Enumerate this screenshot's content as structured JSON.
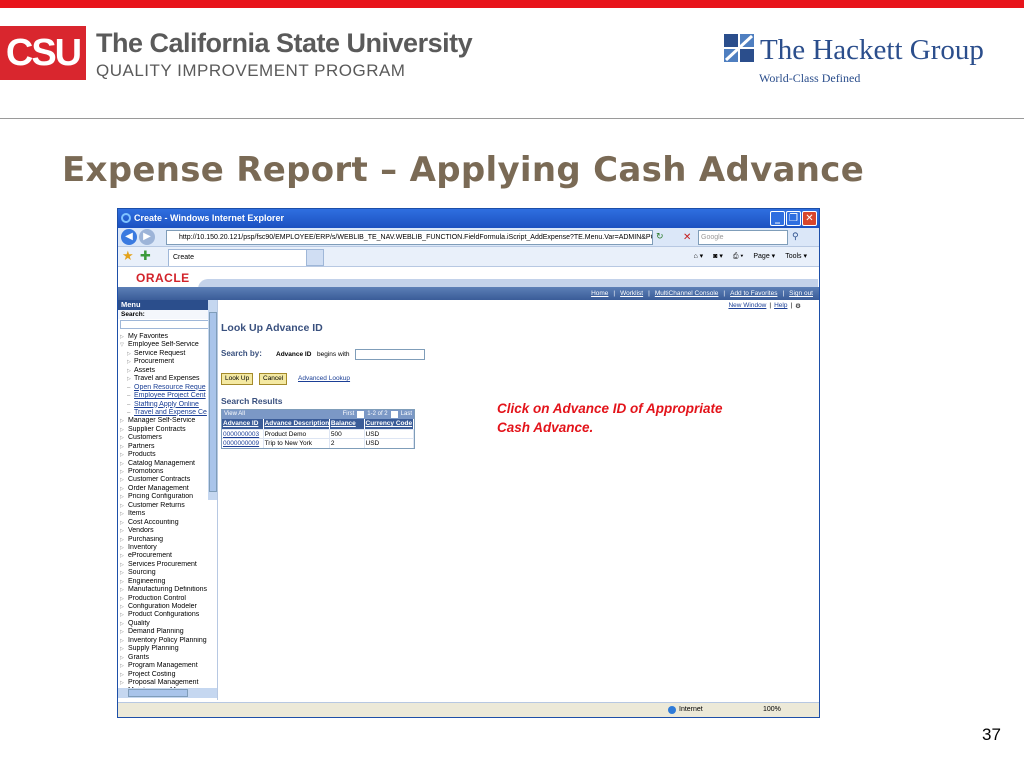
{
  "slide": {
    "csu_abbrev": "CSU",
    "university": "The California State University",
    "program": "QUALITY IMPROVEMENT PROGRAM",
    "partner": "The Hackett Group",
    "partner_tagline": "World-Class Defined",
    "title": "Expense Report – Applying Cash Advance",
    "page_number": "37",
    "callout": "Click on Advance ID of Appropriate Cash Advance.",
    "colors": {
      "accent_red": "#e8141b",
      "title_brown": "#7a6a55",
      "hackett_blue": "#2b4e8c"
    }
  },
  "browser": {
    "window_title": "Create - Windows Internet Explorer",
    "url": "http://10.150.20.121/psp/fsc90/EMPLOYEE/ERP/s/WEBLIB_TE_NAV.WEBLIB_FUNCTION.FieldFormula.iScript_AddExpense?TE.Menu.Var=ADMIN&PORTALI",
    "search_placeholder": "Google",
    "tab_label": "Create",
    "page_menu": "Page ▾",
    "tools_menu": "Tools ▾",
    "status_zone": "Internet",
    "zoom": "100%"
  },
  "ps_header": {
    "brand": "ORACLE",
    "links": [
      "Home",
      "Worklist",
      "MultiChannel Console",
      "Add to Favorites",
      "Sign out"
    ]
  },
  "menu": {
    "title": "Menu",
    "search_label": "Search:",
    "items": [
      {
        "label": "My Favorites",
        "kind": "top"
      },
      {
        "label": "Employee Self-Service",
        "kind": "open"
      },
      {
        "label": "Service Request",
        "kind": "sub"
      },
      {
        "label": "Procurement",
        "kind": "sub"
      },
      {
        "label": "Assets",
        "kind": "sub"
      },
      {
        "label": "Travel and Expenses",
        "kind": "sub"
      },
      {
        "label": "Open Resource Reque",
        "kind": "link"
      },
      {
        "label": "Employee Project Cent",
        "kind": "link"
      },
      {
        "label": "Staffing Apply Online",
        "kind": "link"
      },
      {
        "label": "Travel and Expense Ce",
        "kind": "link"
      },
      {
        "label": "Manager Self-Service",
        "kind": "top"
      },
      {
        "label": "Supplier Contracts",
        "kind": "top"
      },
      {
        "label": "Customers",
        "kind": "top"
      },
      {
        "label": "Partners",
        "kind": "top"
      },
      {
        "label": "Products",
        "kind": "top"
      },
      {
        "label": "Catalog Management",
        "kind": "top"
      },
      {
        "label": "Promotions",
        "kind": "top"
      },
      {
        "label": "Customer Contracts",
        "kind": "top"
      },
      {
        "label": "Order Management",
        "kind": "top"
      },
      {
        "label": "Pricing Configuration",
        "kind": "top"
      },
      {
        "label": "Customer Returns",
        "kind": "top"
      },
      {
        "label": "Items",
        "kind": "top"
      },
      {
        "label": "Cost Accounting",
        "kind": "top"
      },
      {
        "label": "Vendors",
        "kind": "top"
      },
      {
        "label": "Purchasing",
        "kind": "top"
      },
      {
        "label": "Inventory",
        "kind": "top"
      },
      {
        "label": "eProcurement",
        "kind": "top"
      },
      {
        "label": "Services Procurement",
        "kind": "top"
      },
      {
        "label": "Sourcing",
        "kind": "top"
      },
      {
        "label": "Engineering",
        "kind": "top"
      },
      {
        "label": "Manufacturing Definitions",
        "kind": "top"
      },
      {
        "label": "Production Control",
        "kind": "top"
      },
      {
        "label": "Configuration Modeler",
        "kind": "top"
      },
      {
        "label": "Product Configurations",
        "kind": "top"
      },
      {
        "label": "Quality",
        "kind": "top"
      },
      {
        "label": "Demand Planning",
        "kind": "top"
      },
      {
        "label": "Inventory Policy Planning",
        "kind": "top"
      },
      {
        "label": "Supply Planning",
        "kind": "top"
      },
      {
        "label": "Grants",
        "kind": "top"
      },
      {
        "label": "Program Management",
        "kind": "top"
      },
      {
        "label": "Project Costing",
        "kind": "top"
      },
      {
        "label": "Proposal Management",
        "kind": "top"
      },
      {
        "label": "Maintenance Manageme",
        "kind": "top"
      }
    ]
  },
  "lookup": {
    "new_window": "New Window",
    "help": "Help",
    "title": "Look Up Advance ID",
    "search_by": "Search by:",
    "field_label": "Advance ID",
    "operator": "begins with",
    "search_value": "",
    "lookup_button": "Look Up",
    "cancel_button": "Cancel",
    "advanced_lookup": "Advanced Lookup",
    "results_title": "Search Results",
    "view_all": "View All",
    "first": "First",
    "range": "1-2 of 2",
    "last": "Last",
    "columns": [
      "Advance ID",
      "Advance Description",
      "Balance",
      "Currency Code"
    ],
    "rows": [
      [
        "0000000003",
        "Product Demo",
        "500",
        "USD"
      ],
      [
        "0000000009",
        "Trip to New York",
        "2",
        "USD"
      ]
    ]
  }
}
